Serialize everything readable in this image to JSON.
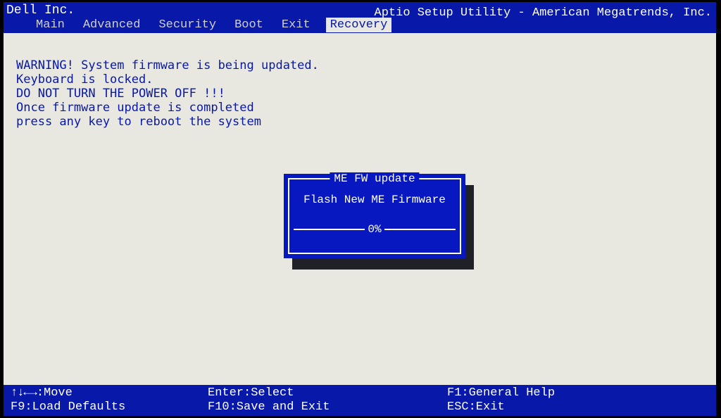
{
  "vendor": "Dell Inc.",
  "utility": "Aptio Setup Utility - American Megatrends, Inc.",
  "tabs": {
    "items": [
      "Main",
      "Advanced",
      "Security",
      "Boot",
      "Exit",
      "Recovery"
    ],
    "active_index": 5
  },
  "warning_lines": [
    "WARNING! System firmware is being updated.",
    "Keyboard is locked.",
    "DO NOT TURN THE POWER OFF !!!",
    "Once firmware update is completed",
    "press any key to reboot the system"
  ],
  "dialog": {
    "title": "ME FW update",
    "body": "Flash New ME Firmware",
    "progress_text": "0%"
  },
  "footer": {
    "move_arrows": "↑↓←→",
    "move_label": ":Move",
    "select": "Enter:Select",
    "help": "F1:General Help",
    "defaults": "F9:Load Defaults",
    "save": "F10:Save and Exit",
    "exit": "ESC:Exit"
  }
}
